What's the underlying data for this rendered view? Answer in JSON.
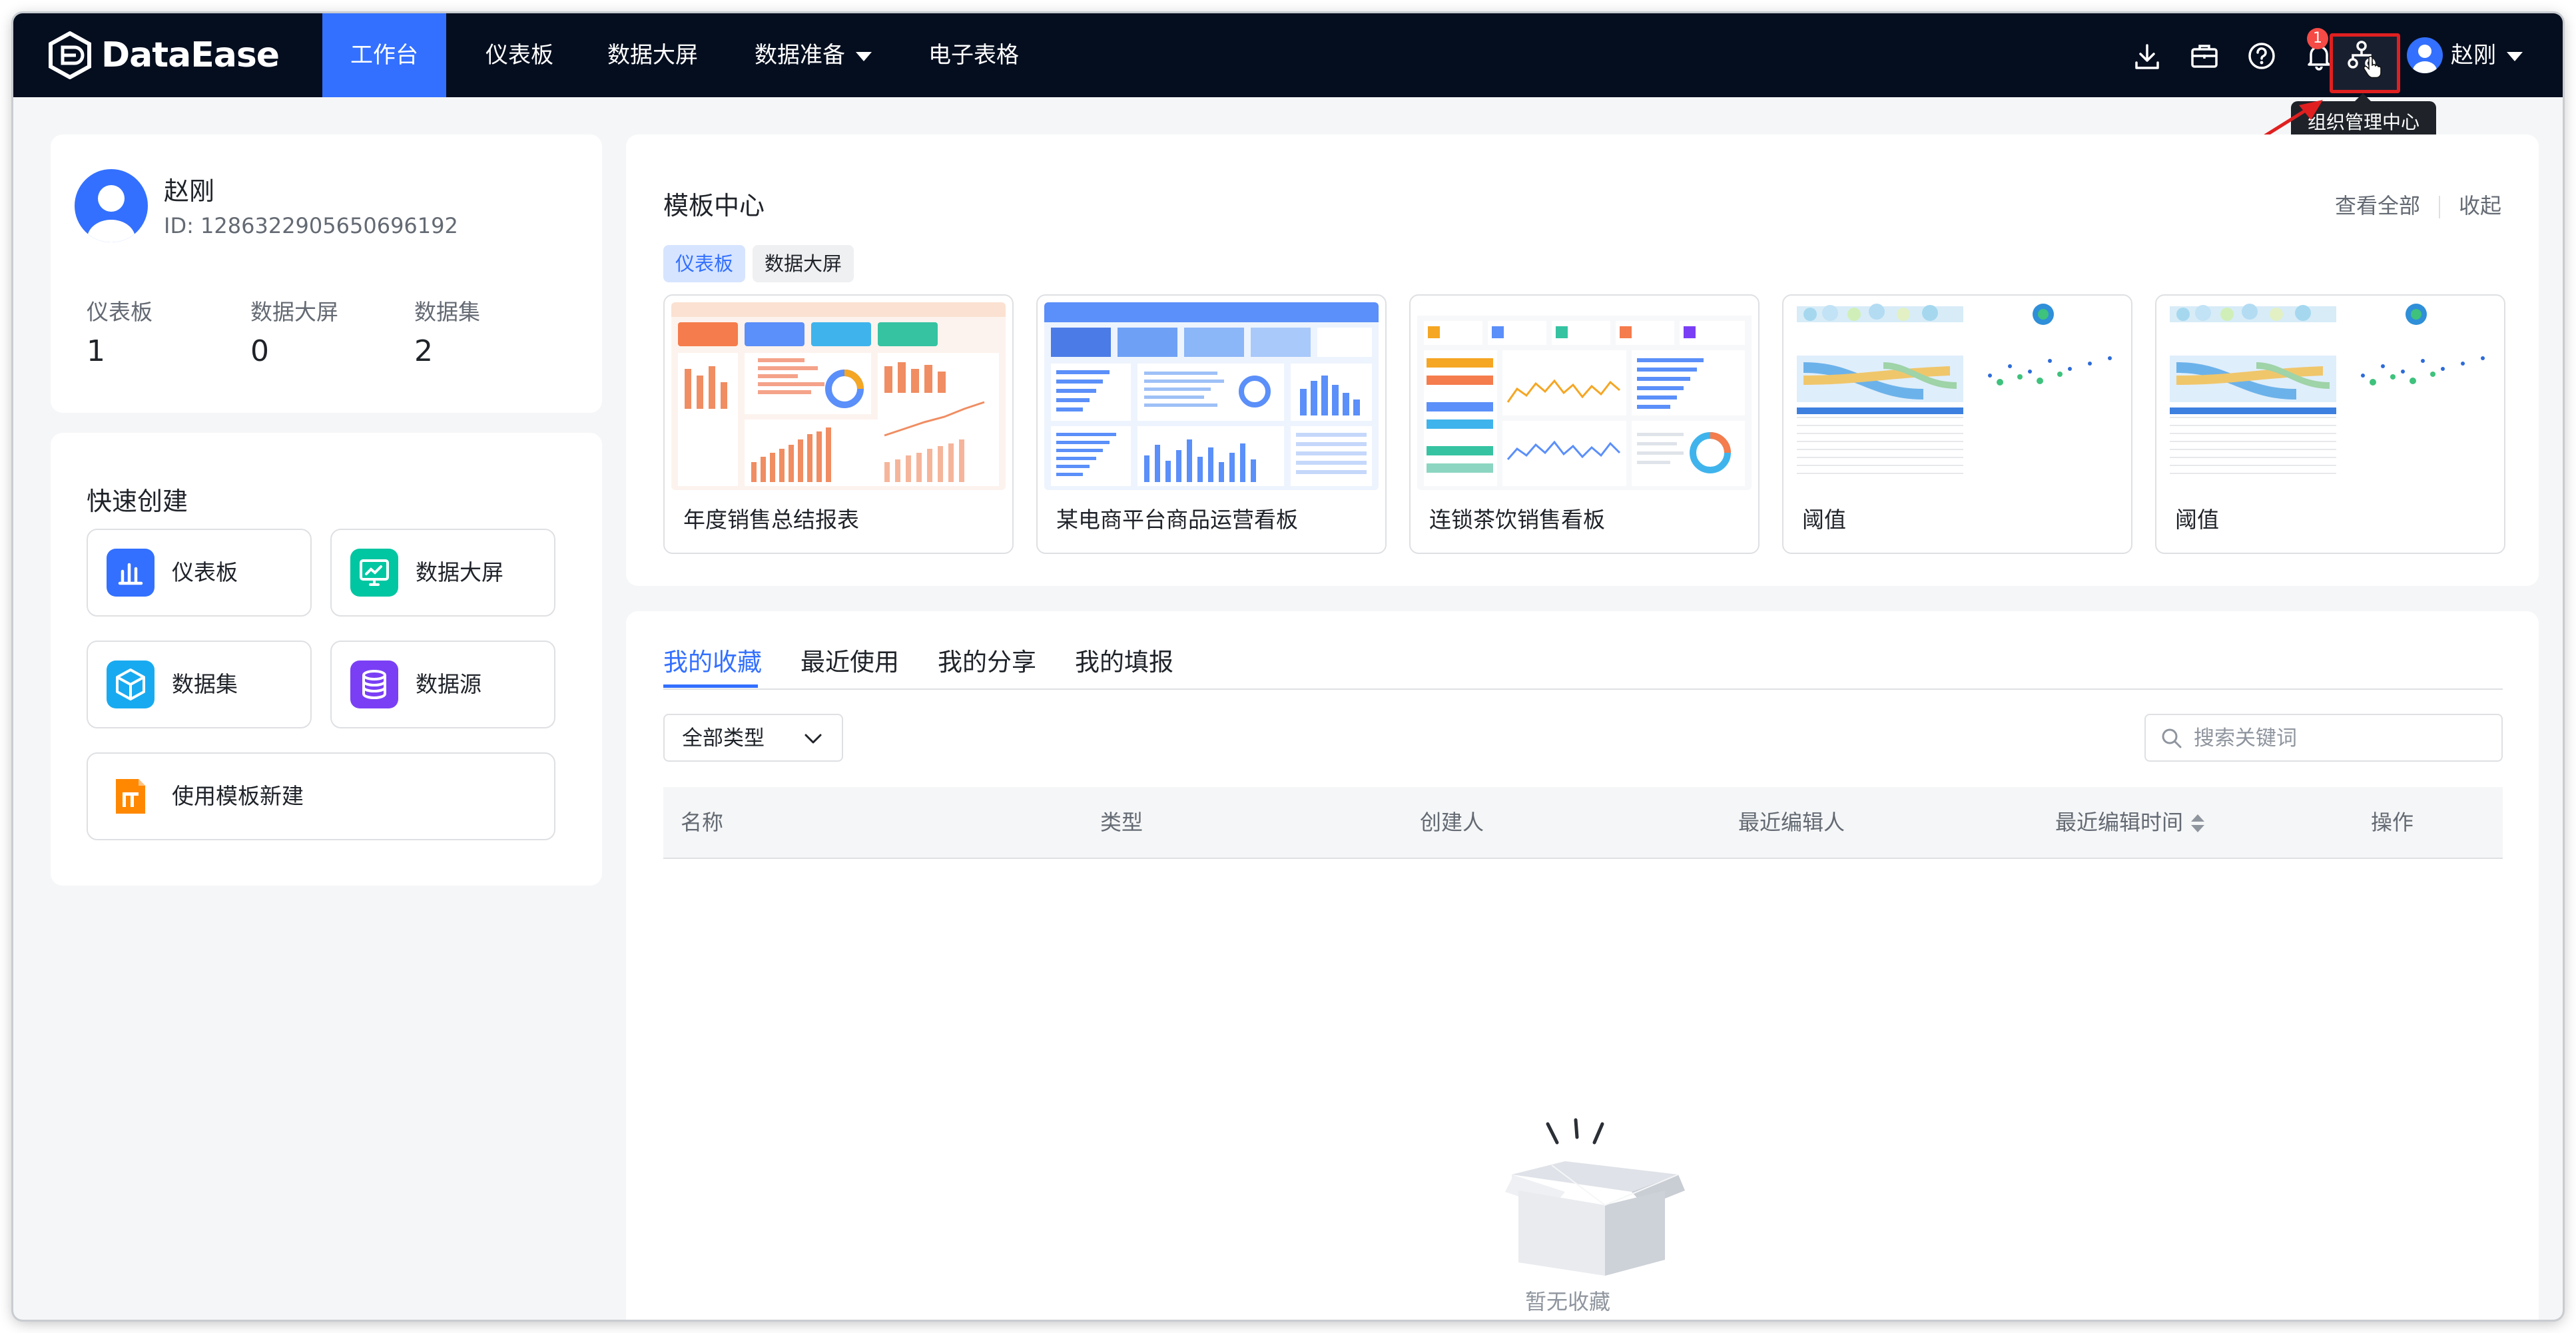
{
  "app": {
    "logo_text": "DataEase"
  },
  "nav": {
    "items": [
      {
        "label": "工作台",
        "active": true
      },
      {
        "label": "仪表板",
        "active": false
      },
      {
        "label": "数据大屏",
        "active": false
      },
      {
        "label": "数据准备",
        "active": false,
        "has_dropdown": true
      },
      {
        "label": "电子表格",
        "active": false
      }
    ]
  },
  "toolbar": {
    "icons": [
      "download-icon",
      "briefcase-icon",
      "help-icon",
      "bell-icon",
      "org-tree-icon"
    ],
    "notification_count": "1",
    "user_name": "赵刚",
    "tooltip": "组织管理中心"
  },
  "profile": {
    "name": "赵刚",
    "id": "ID: 1286322905650696192",
    "stats": [
      {
        "label": "仪表板",
        "value": "1"
      },
      {
        "label": "数据大屏",
        "value": "0"
      },
      {
        "label": "数据集",
        "value": "2"
      }
    ]
  },
  "quick_create": {
    "title": "快速创建",
    "items": [
      {
        "label": "仪表板",
        "icon": "bar-chart-icon",
        "color": "#3370ff"
      },
      {
        "label": "数据大屏",
        "icon": "monitor-icon",
        "color": "#00c6a1"
      },
      {
        "label": "数据集",
        "icon": "cube-icon",
        "color": "#18aaf0"
      },
      {
        "label": "数据源",
        "icon": "database-icon",
        "color": "#7a3ff5"
      },
      {
        "label": "使用模板新建",
        "icon": "template-icon",
        "color": "#ff8800"
      }
    ]
  },
  "template_center": {
    "title": "模板中心",
    "view_all": "查看全部",
    "collapse": "收起",
    "tags": [
      "仪表板",
      "数据大屏"
    ],
    "cards": [
      {
        "name": "年度销售总结报表"
      },
      {
        "name": "某电商平台商品运营看板"
      },
      {
        "name": "连锁茶饮销售看板"
      },
      {
        "name": "阈值"
      },
      {
        "name": "阈值"
      }
    ]
  },
  "resources": {
    "tabs": [
      "我的收藏",
      "最近使用",
      "我的分享",
      "我的填报"
    ],
    "type_filter": "全部类型",
    "search_placeholder": "搜索关键词",
    "columns": [
      "名称",
      "类型",
      "创建人",
      "最近编辑人",
      "最近编辑时间",
      "操作"
    ],
    "empty_text": "暂无收藏"
  },
  "colors": {
    "topbar": "#050e1f",
    "accent": "#3370ff",
    "highlight_box": "#e02020"
  }
}
